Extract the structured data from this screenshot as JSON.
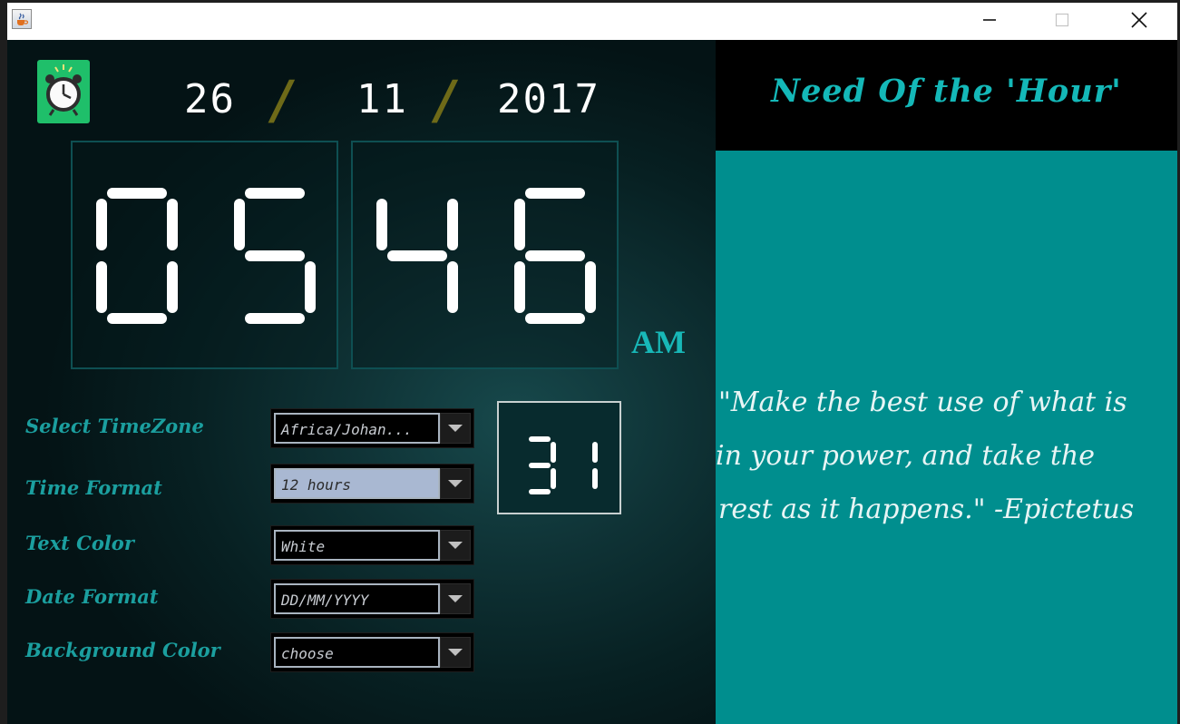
{
  "window": {
    "icon": "java-cup-icon",
    "controls": [
      "minimize-icon",
      "maximize-icon",
      "close-icon"
    ]
  },
  "clock": {
    "date_day": "26",
    "date_month": "11",
    "date_year": "2017",
    "date_separator": "/",
    "hours": "05",
    "minutes": "46",
    "seconds": "31",
    "ampm": "AM",
    "alarm_icon": "alarm-clock-icon"
  },
  "settings": {
    "timezone": {
      "label": "Select TimeZone",
      "value": "Africa/Johan..."
    },
    "time_format": {
      "label": "Time Format",
      "value": "12 hours"
    },
    "text_color": {
      "label": "Text Color",
      "value": "White"
    },
    "date_format": {
      "label": "Date Format",
      "value": "DD/MM/YYYY"
    },
    "background_color": {
      "label": "Background Color",
      "value": "choose"
    }
  },
  "quote_panel": {
    "title": "Need Of the 'Hour'",
    "quote_lines": [
      "\"Make the best use of what is",
      "in your power, and take the",
      "rest as it happens.\" -Epictetus"
    ]
  },
  "colors": {
    "accent": "#14b8b8",
    "quote_panel_bg": "#008e8e",
    "digit_color": "#ffffff",
    "slash_color": "#6e6a18"
  }
}
